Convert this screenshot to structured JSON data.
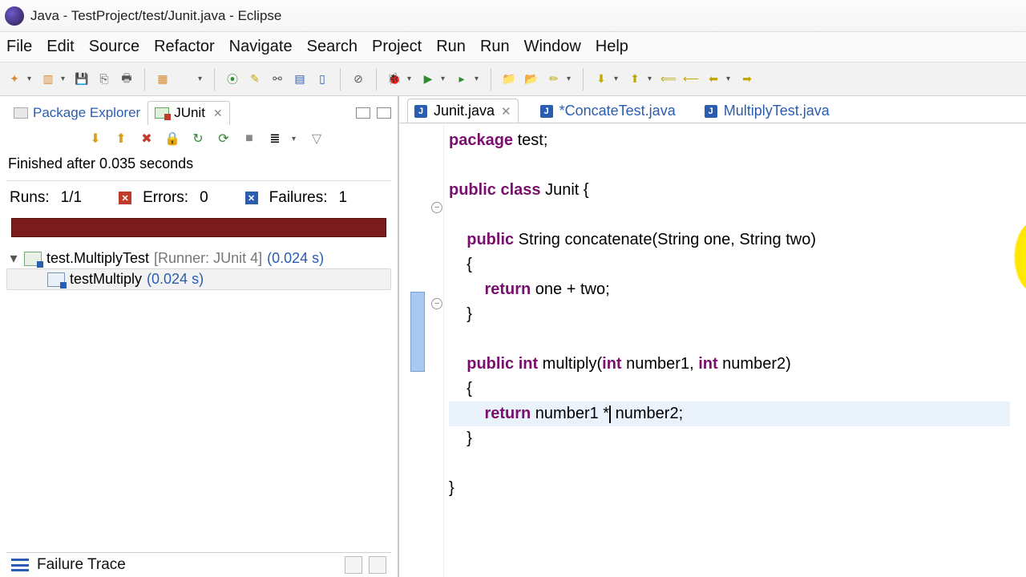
{
  "window": {
    "title": "Java - TestProject/test/Junit.java - Eclipse"
  },
  "menu": [
    "File",
    "Edit",
    "Source",
    "Refactor",
    "Navigate",
    "Search",
    "Project",
    "Run",
    "Run",
    "Window",
    "Help"
  ],
  "views": {
    "package_explorer": "Package Explorer",
    "junit": "JUnit"
  },
  "junit": {
    "status": "Finished after 0.035 seconds",
    "runs_label": "Runs:",
    "runs_value": "1/1",
    "errors_label": "Errors:",
    "errors_value": "0",
    "failures_label": "Failures:",
    "failures_value": "1",
    "tree": {
      "root": {
        "label": "test.MultiplyTest",
        "runner": "[Runner: JUnit 4]",
        "time": "(0.024 s)"
      },
      "child": {
        "label": "testMultiply",
        "time": "(0.024 s)"
      }
    },
    "failure_trace": "Failure Trace"
  },
  "editor_tabs": {
    "t1": "Junit.java",
    "t2": "*ConcateTest.java",
    "t3": "MultiplyTest.java"
  },
  "code": {
    "l1a": "package",
    "l1b": " test;",
    "l2a": "public",
    "l2b": " ",
    "l2c": "class",
    "l2d": " Junit {",
    "l3a": "public",
    "l3b": " String concatenate(String one, String two)",
    "l4": "{",
    "l5a": "return",
    "l5b": " one + two;",
    "l6": "}",
    "l7a": "public",
    "l7b": " ",
    "l7c": "int",
    "l7d": " multiply(",
    "l7e": "int",
    "l7f": " number1, ",
    "l7g": "int",
    "l7h": " number2)",
    "l8": "{",
    "l9a": "return",
    "l9b": " number1 *",
    "l9c": " number2;",
    "l10": "}",
    "l11": "}"
  }
}
